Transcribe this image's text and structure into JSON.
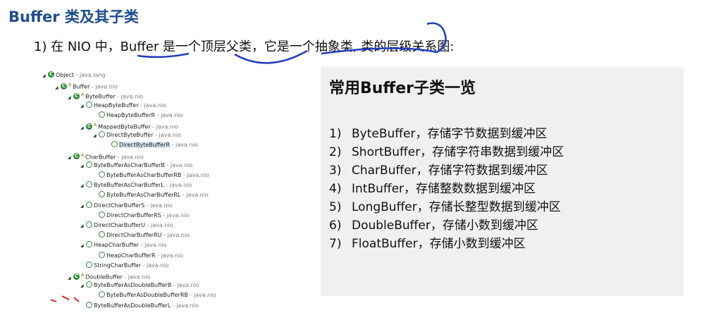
{
  "heading": "Buffer 类及其子类",
  "subtitle": "1) 在 NIO 中，Buffer 是一个顶层父类，它是一个抽象类, 类的层级关系图:",
  "panel": {
    "title": "常用Buffer子类一览",
    "items": [
      {
        "num": "1)",
        "text": "ByteBuffer，存储字节数据到缓冲区"
      },
      {
        "num": "2)",
        "text": "ShortBuffer，存储字符串数据到缓冲区"
      },
      {
        "num": "3)",
        "text": "CharBuffer，存储字符数据到缓冲区"
      },
      {
        "num": "4)",
        "text": "IntBuffer，存储整数数据到缓冲区"
      },
      {
        "num": "5)",
        "text": "LongBuffer，存储长整型数据到缓冲区"
      },
      {
        "num": "6)",
        "text": "DoubleBuffer，存储小数到缓冲区"
      },
      {
        "num": "7)",
        "text": "FloatBuffer，存储小数到缓冲区"
      }
    ]
  },
  "tree": [
    {
      "name": "Object",
      "pkg": "java.lang",
      "level": 0,
      "icon": "o"
    },
    {
      "name": "Buffer",
      "pkg": "java.nio",
      "level": 1,
      "icon": "c",
      "abstract": true
    },
    {
      "name": "ByteBuffer",
      "pkg": "java.nio",
      "level": 2,
      "icon": "c",
      "abstract": true
    },
    {
      "name": "HeapByteBuffer",
      "pkg": "java.nio",
      "level": 3,
      "icon": "q"
    },
    {
      "name": "HeapByteBufferR",
      "pkg": "java.nio",
      "level": 4,
      "icon": "q"
    },
    {
      "name": "MappedByteBuffer",
      "pkg": "java.nio",
      "level": 3,
      "icon": "c",
      "abstract": true
    },
    {
      "name": "DirectByteBuffer",
      "pkg": "java.nio",
      "level": 4,
      "icon": "q"
    },
    {
      "name": "DirectByteBufferR",
      "pkg": "java.nio",
      "level": 5,
      "icon": "q",
      "selected": true
    },
    {
      "name": "CharBuffer",
      "pkg": "java.nio",
      "level": 2,
      "icon": "c",
      "abstract": true
    },
    {
      "name": "ByteBufferAsCharBufferB",
      "pkg": "java.nio",
      "level": 3,
      "icon": "q"
    },
    {
      "name": "ByteBufferAsCharBufferRB",
      "pkg": "java.nio",
      "level": 4,
      "icon": "q"
    },
    {
      "name": "ByteBufferAsCharBufferL",
      "pkg": "java.nio",
      "level": 3,
      "icon": "q"
    },
    {
      "name": "ByteBufferAsCharBufferRL",
      "pkg": "java.nio",
      "level": 4,
      "icon": "q"
    },
    {
      "name": "DirectCharBufferS",
      "pkg": "java.nio",
      "level": 3,
      "icon": "q"
    },
    {
      "name": "DirectCharBufferRS",
      "pkg": "java.nio",
      "level": 4,
      "icon": "q"
    },
    {
      "name": "DirectCharBufferU",
      "pkg": "java.nio",
      "level": 3,
      "icon": "q"
    },
    {
      "name": "DirectCharBufferRU",
      "pkg": "java.nio",
      "level": 4,
      "icon": "q"
    },
    {
      "name": "HeapCharBuffer",
      "pkg": "java.nio",
      "level": 3,
      "icon": "q"
    },
    {
      "name": "HeapCharBufferR",
      "pkg": "java.nio",
      "level": 4,
      "icon": "q"
    },
    {
      "name": "StringCharBuffer",
      "pkg": "java.nio",
      "level": 3,
      "icon": "q"
    },
    {
      "name": "DoubleBuffer",
      "pkg": "java.nio",
      "level": 2,
      "icon": "c",
      "abstract": true
    },
    {
      "name": "ByteBufferAsDoubleBufferB",
      "pkg": "java.nio",
      "level": 3,
      "icon": "q"
    },
    {
      "name": "ByteBufferAsDoubleBufferRB",
      "pkg": "java.nio",
      "level": 4,
      "icon": "q"
    },
    {
      "name": "ByteBufferAsDoubleBufferL",
      "pkg": "java.nio",
      "level": 3,
      "icon": "q"
    }
  ]
}
